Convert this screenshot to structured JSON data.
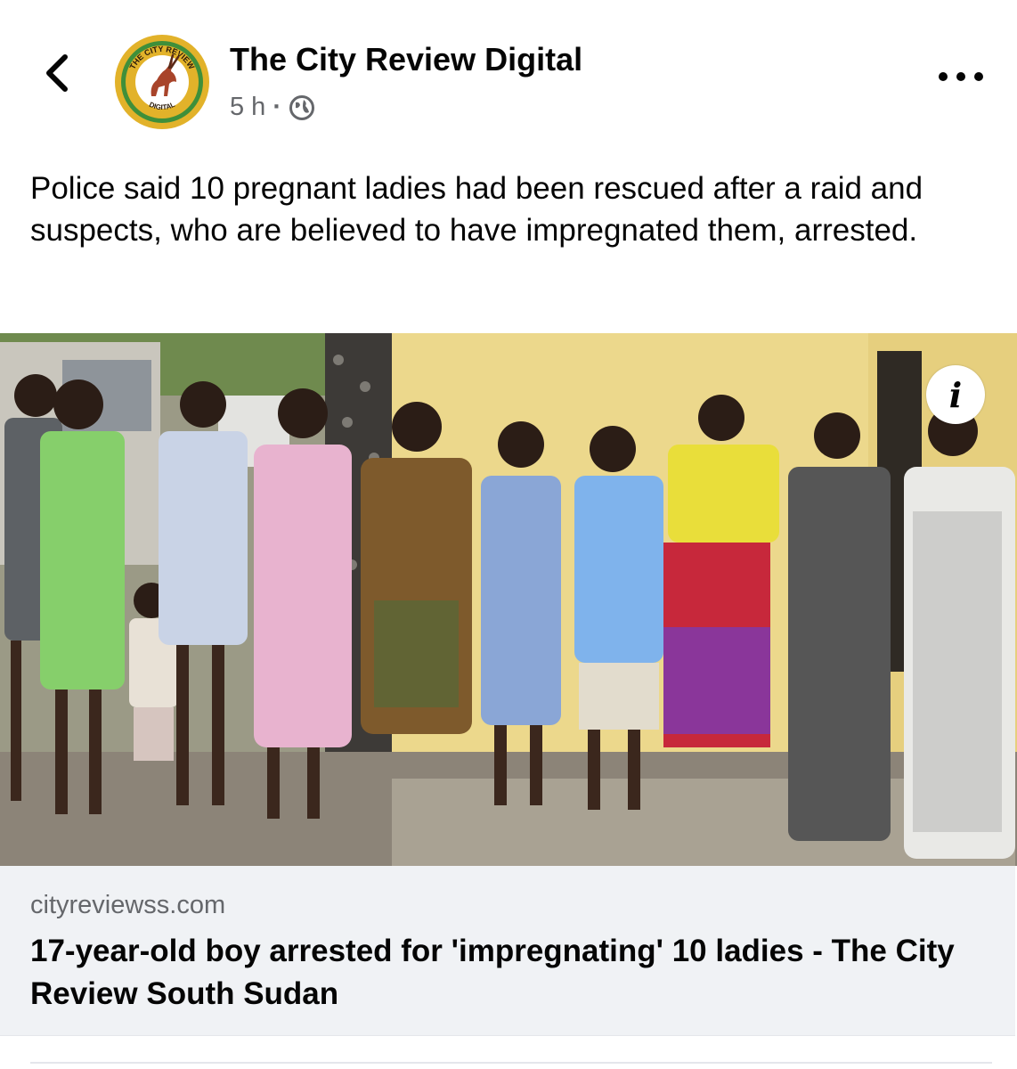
{
  "header": {
    "back_icon": "chevron-left-icon",
    "page_name": "The City Review Digital",
    "timestamp": "5 h",
    "separator": "·",
    "audience_icon": "globe-icon",
    "more_icon": "more-horizontal-icon"
  },
  "logo": {
    "top_text": "THE CITY REVIEW",
    "bottom_text": "DIGITAL",
    "colors": {
      "ring": "#e2b22a",
      "wreath": "#3f8f3a",
      "inner": "#ffffff",
      "animal": "#a8442a"
    }
  },
  "post": {
    "text": "Police said 10 pregnant ladies had been rescued after a raid and suspects, who are believed to have impregnated them, arrested."
  },
  "photo": {
    "info_label": "i"
  },
  "link_preview": {
    "domain": "cityreviewss.com",
    "title": "17-year-old boy arrested for 'impregnating' 10 ladies - The City Review South Sudan"
  },
  "colors": {
    "text_primary": "#050505",
    "text_secondary": "#65676b",
    "card_bg": "#f0f2f5",
    "wall": "#ecd88c"
  }
}
